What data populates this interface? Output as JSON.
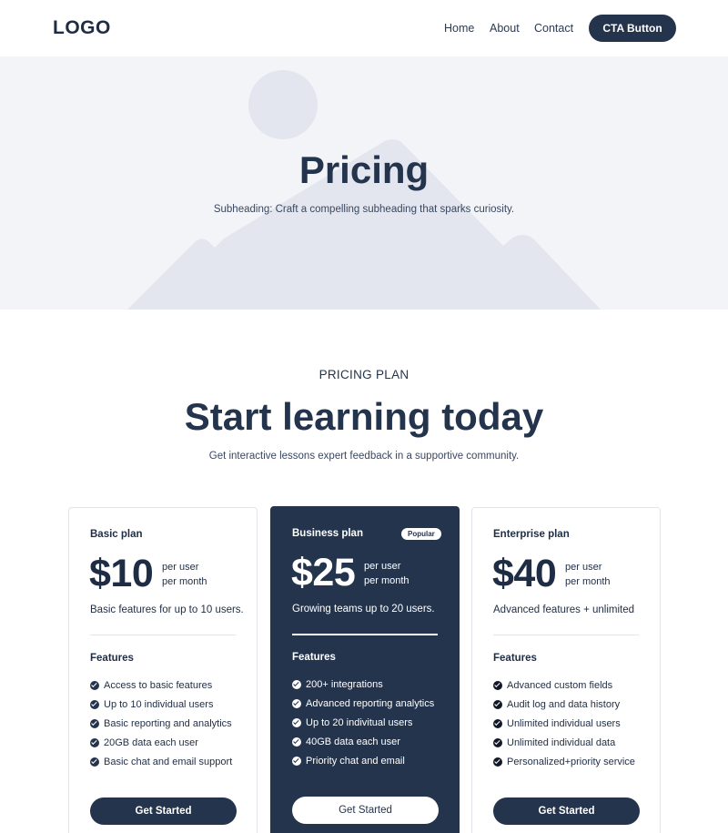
{
  "header": {
    "logo": "LOGO",
    "nav": [
      "Home",
      "About",
      "Contact"
    ],
    "cta_label": "CTA Button"
  },
  "hero": {
    "title": "Pricing",
    "subtitle": "Subheading: Craft a compelling subheading that sparks curiosity.",
    "art": "image-placeholder-icon"
  },
  "section": {
    "eyebrow": "PRICING PLAN",
    "title": "Start learning today",
    "subtitle": "Get interactive lessons expert feedback in a supportive community."
  },
  "plans": [
    {
      "name": "Basic plan",
      "price": "$10",
      "per_user": "per user",
      "per_month": "per month",
      "description": "Basic features for up to 10 users.",
      "features_title": "Features",
      "features": [
        "Access to basic features",
        "Up to 10 individual users",
        "Basic reporting and analytics",
        "20GB data each user",
        "Basic chat and email support"
      ],
      "button": "Get Started"
    },
    {
      "name": "Business plan",
      "badge": "Popular",
      "price": "$25",
      "per_user": "per user",
      "per_month": "per month",
      "description": "Growing teams up to 20 users.",
      "features_title": "Features",
      "features": [
        "200+ integrations",
        "Advanced reporting analytics",
        "Up to 20 indivitual users",
        "40GB data each user",
        "Priority chat and email"
      ],
      "button": "Get Started"
    },
    {
      "name": "Enterprise plan",
      "price": "$40",
      "per_user": "per user",
      "per_month": "per month",
      "description": "Advanced features + unlimited",
      "features_title": "Features",
      "features": [
        "Advanced custom fields",
        "Audit log and data history",
        "Unlimited individual users",
        "Unlimited individual data",
        "Personalized+priority service"
      ],
      "button": "Get Started"
    }
  ],
  "colors": {
    "primary": "#24344d",
    "hero_bg": "#f3f4f8",
    "placeholder_shape": "#e3e6ef",
    "border": "#e1e4ea"
  },
  "icons": {
    "check": "check-circle-icon"
  }
}
